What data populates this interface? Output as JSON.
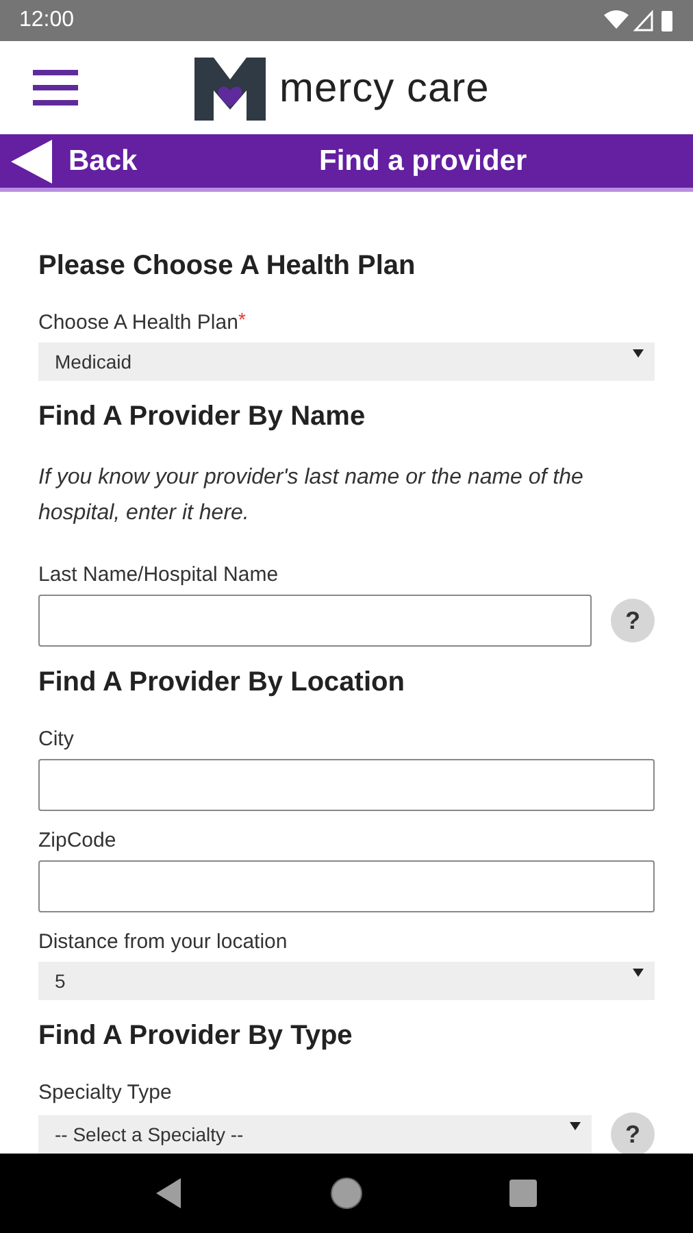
{
  "status_bar": {
    "time": "12:00"
  },
  "header": {
    "logo_text": "mercy care"
  },
  "required_symbol": "*",
  "help_symbol": "?",
  "nav_bar": {
    "back_label": "Back",
    "title": "Find a provider"
  },
  "sections": [
    {
      "title": "Please Choose A Health Plan",
      "fields": [
        {
          "kind": "select",
          "label": "Choose A Health Plan",
          "required": true,
          "value": "Medicaid",
          "help": false
        }
      ]
    },
    {
      "title": "Find A Provider By Name",
      "hint": "If you know your provider's last name or the name of the hospital, enter it here.",
      "fields": [
        {
          "kind": "text",
          "label": "Last Name/Hospital Name",
          "required": false,
          "help": true
        }
      ]
    },
    {
      "title": "Find A Provider By Location",
      "fields": [
        {
          "kind": "text",
          "label": "City",
          "required": false,
          "help": false
        },
        {
          "kind": "text",
          "label": "ZipCode",
          "required": false,
          "help": false
        },
        {
          "kind": "select",
          "label": "Distance from your location",
          "required": false,
          "value": "5",
          "help": false
        }
      ]
    },
    {
      "title": "Find A Provider By Type",
      "fields": [
        {
          "kind": "select",
          "label": "Specialty Type",
          "required": false,
          "value": "-- Select a Specialty --",
          "help": true
        }
      ]
    }
  ]
}
